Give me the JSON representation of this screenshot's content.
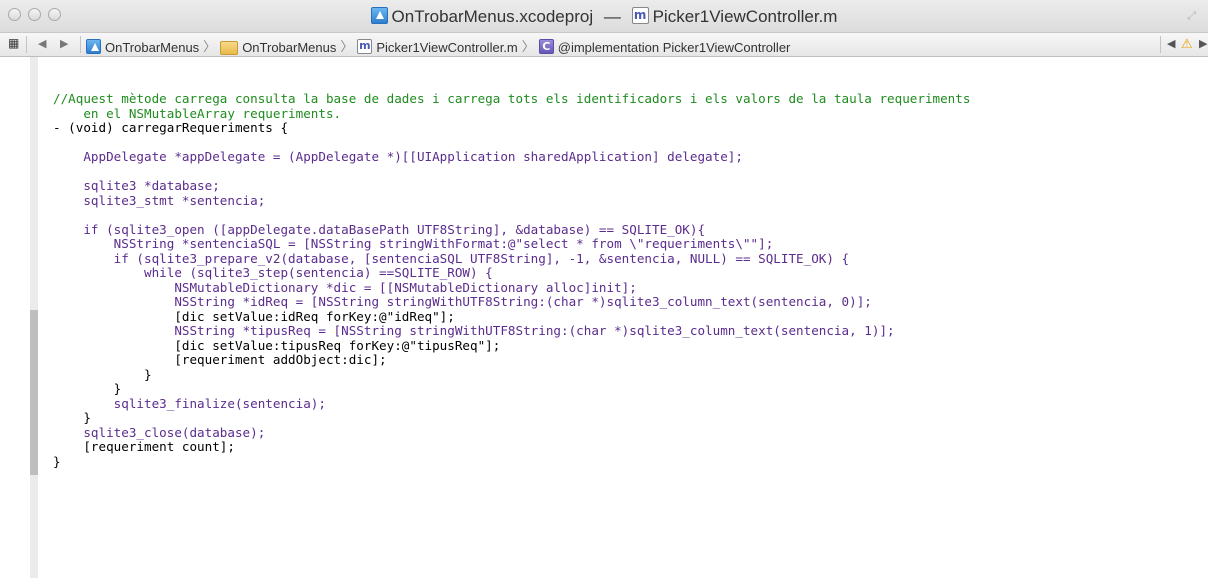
{
  "window": {
    "project_name": "OnTrobarMenus.xcodeproj",
    "title_separator": "—",
    "file_name": "Picker1ViewController.m",
    "resize_icon": "fullscreen-icon"
  },
  "jump_bar": {
    "related_items_icon": "grid-icon",
    "back_icon": "back-arrow-icon",
    "forward_icon": "forward-arrow-icon",
    "crumbs": [
      {
        "label": "OnTrobarMenus",
        "icon": "xcodeproj-icon"
      },
      {
        "label": "OnTrobarMenus",
        "icon": "folder-icon"
      },
      {
        "label": "Picker1ViewController.m",
        "icon": "m-file-icon"
      },
      {
        "label": "@implementation Picker1ViewController",
        "icon": "class-icon"
      }
    ],
    "right_icons": [
      "previous-issue-icon",
      "warning-icon",
      "next-issue-icon"
    ]
  },
  "code_lines": [
    "//Aquest mètode carrega consulta la base de dades i carrega tots els identificadors i els valors de la taula requeriments",
    "    en el NSMutableArray requeriments.",
    "- (void) carregarRequeriments {",
    "",
    "    AppDelegate *appDelegate = (AppDelegate *)[[UIApplication sharedApplication] delegate];",
    "",
    "    sqlite3 *database;",
    "    sqlite3_stmt *sentencia;",
    "",
    "    if (sqlite3_open ([appDelegate.dataBasePath UTF8String], &database) == SQLITE_OK){",
    "        NSString *sentenciaSQL = [NSString stringWithFormat:@\"select * from \\\"requeriments\\\"\"];",
    "        if (sqlite3_prepare_v2(database, [sentenciaSQL UTF8String], -1, &sentencia, NULL) == SQLITE_OK) {",
    "            while (sqlite3_step(sentencia) ==SQLITE_ROW) {",
    "                NSMutableDictionary *dic = [[NSMutableDictionary alloc]init];",
    "                NSString *idReq = [NSString stringWithUTF8String:(char *)sqlite3_column_text(sentencia, 0)];",
    "                [dic setValue:idReq forKey:@\"idReq\"];",
    "                NSString *tipusReq = [NSString stringWithUTF8String:(char *)sqlite3_column_text(sentencia, 1)];",
    "                [dic setValue:tipusReq forKey:@\"tipusReq\"];",
    "                [requeriment addObject:dic];",
    "            }",
    "        }",
    "        sqlite3_finalize(sentencia);",
    "    }",
    "    sqlite3_close(database);",
    "    [requeriment count];",
    "}"
  ]
}
